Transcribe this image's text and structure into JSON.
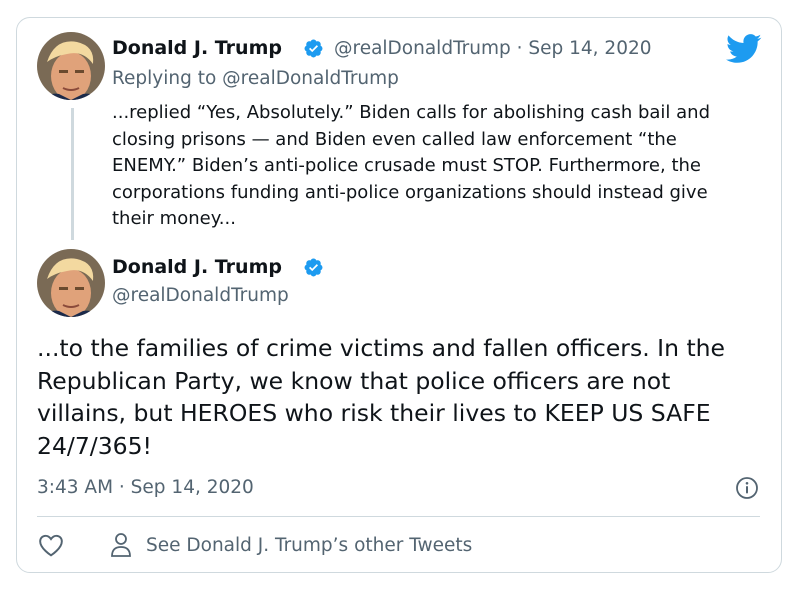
{
  "reply_tweet": {
    "author_name": "Donald J. Trump",
    "handle_and_date": "@realDonaldTrump · Sep 14, 2020",
    "replying_to": "Replying to @realDonaldTrump",
    "text": "...replied “Yes, Absolutely.” Biden calls for abolishing cash bail and closing prisons — and Biden even called law enforcement “the ENEMY.” Biden’s anti-police crusade must STOP. Furthermore, the corporations funding anti-police organizations should instead give their money..."
  },
  "main_tweet": {
    "author_name": "Donald J. Trump",
    "handle": "@realDonaldTrump",
    "text": "...to the families of crime victims and fallen officers. In the Republican Party, we know that police officers are not villains, but HEROES who risk their lives to KEEP US SAFE 24/7/365!",
    "timestamp": "3:43 AM · Sep 14, 2020"
  },
  "footer": {
    "see_other_label": "See Donald J. Trump’s other Tweets"
  },
  "colors": {
    "twitter_blue": "#1d9bf0",
    "muted_text": "#536471",
    "border": "#cfd9de"
  }
}
